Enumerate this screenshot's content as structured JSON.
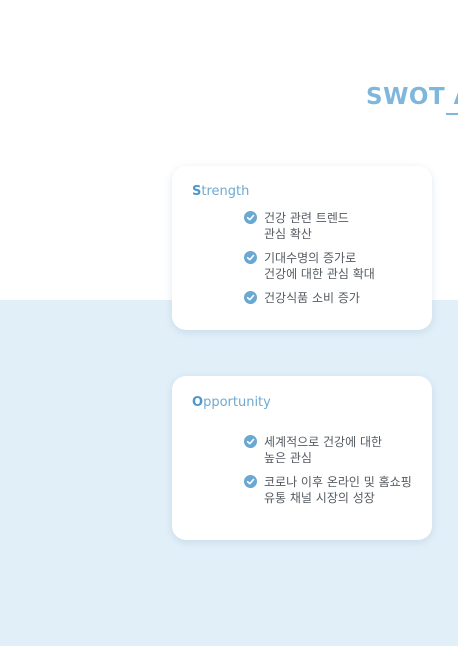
{
  "page": {
    "title": "SWOT A",
    "accent_color": "#7fb6dc",
    "band_color": "#e1eff8"
  },
  "strength": {
    "initial": "S",
    "rest": "trength",
    "icon": "check-circle-icon",
    "points": [
      "건강 관련 트렌드\n관심 확산",
      "기대수명의 증가로\n건강에 대한 관심 확대",
      "건강식품 소비 증가"
    ]
  },
  "opportunity": {
    "initial": "O",
    "rest": "pportunity",
    "icon": "check-circle-icon",
    "points": [
      "세계적으로 건강에 대한\n높은 관심",
      "코로나 이후 온라인 및 홈쇼핑\n유통 채널 시장의 성장"
    ]
  }
}
